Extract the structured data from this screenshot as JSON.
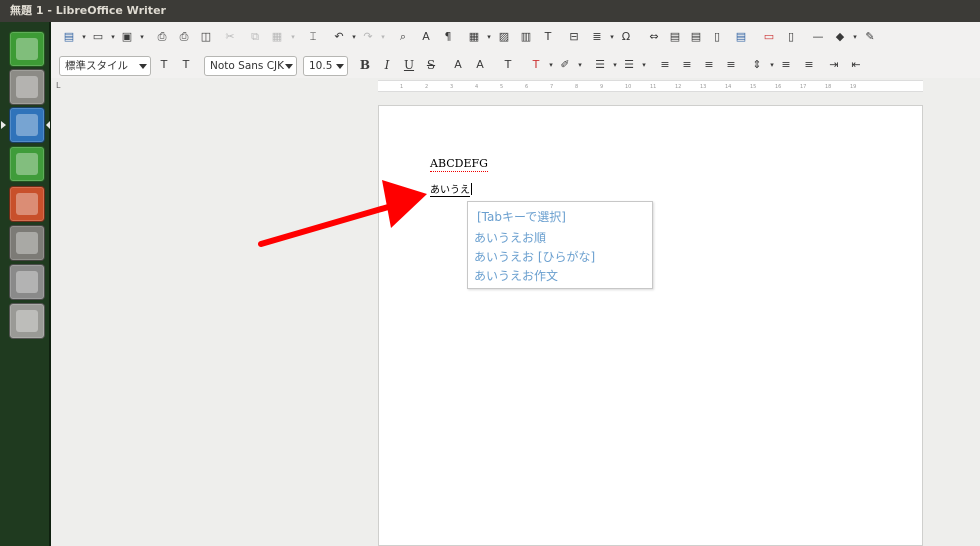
{
  "window": {
    "title": "無題 1 - LibreOffice Writer"
  },
  "launcher": {
    "items": [
      {
        "name": "ubuntu-home-icon",
        "bg": "#3d9b35"
      },
      {
        "name": "files-icon",
        "bg": "#8c8b86"
      },
      {
        "name": "writer-icon",
        "bg": "#2f73ba"
      },
      {
        "name": "calc-icon",
        "bg": "#3f9c3a"
      },
      {
        "name": "impress-icon",
        "bg": "#c8502b"
      },
      {
        "name": "software-center-icon",
        "bg": "#7c7b76"
      },
      {
        "name": "system-settings-icon",
        "bg": "#8a8a8a"
      },
      {
        "name": "drive-icon",
        "bg": "#9a9a96"
      }
    ]
  },
  "formatting": {
    "paragraph_style": "標準スタイル",
    "font_name": "Noto Sans CJK",
    "font_size": "10.5",
    "bold": "B",
    "italic": "I",
    "underline": "U",
    "strike": "S"
  },
  "ruler": {
    "corner": "L",
    "ticks": [
      "1",
      "2",
      "3",
      "4",
      "5",
      "6",
      "7",
      "8",
      "9",
      "10",
      "11",
      "12",
      "13",
      "14",
      "15",
      "16",
      "17",
      "18",
      "19"
    ]
  },
  "document": {
    "line1": "ABCDEFG",
    "line2": "あいうえ"
  },
  "ime_candidates": {
    "header": "[Tabキーで選択]",
    "items": [
      "あいうえお順",
      "あいうえお [ひらがな]",
      "あいうえお作文"
    ]
  },
  "colors": {
    "arrow": "#ff0000",
    "candidate_text": "#6a9fcf",
    "launcher_bg": "#1f3a1f"
  }
}
